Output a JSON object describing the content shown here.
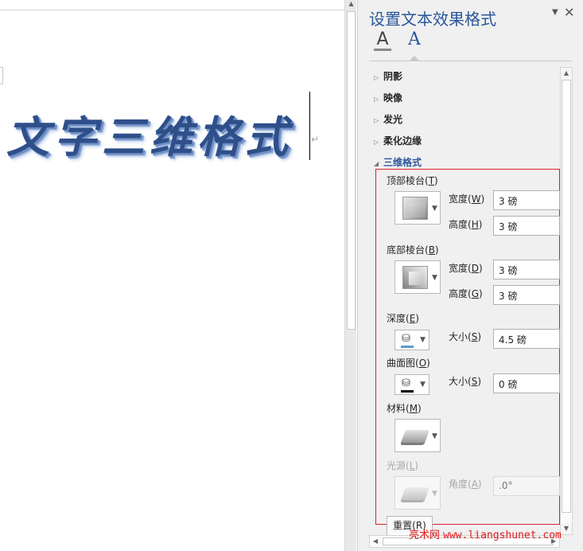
{
  "document": {
    "wordart_text": "文字三维格式",
    "paragraph_mark": "↵"
  },
  "panel": {
    "title": "设置文本效果格式",
    "menu_glyph": "▼",
    "close_glyph": "✕",
    "tabs": {
      "fill_outline_glyph": "A",
      "text_effects_glyph": "A"
    },
    "sections": {
      "shadow": "阴影",
      "reflection": "映像",
      "glow": "发光",
      "soft_edges": "柔化边缘",
      "format_3d": "三维格式"
    },
    "format3d": {
      "top_bevel": {
        "label": "顶部棱台(",
        "key": "T",
        "close": ")"
      },
      "top_width": {
        "label": "宽度(",
        "key": "W",
        "close": ")",
        "value": "3 磅"
      },
      "top_height": {
        "label": "高度(",
        "key": "H",
        "close": ")",
        "value": "3 磅"
      },
      "bottom_bevel": {
        "label": "底部棱台(",
        "key": "B",
        "close": ")"
      },
      "bottom_width": {
        "label": "宽度(",
        "key": "D",
        "close": ")",
        "value": "3 磅"
      },
      "bottom_height": {
        "label": "高度(",
        "key": "G",
        "close": ")",
        "value": "3 磅"
      },
      "depth": {
        "label": "深度(",
        "key": "E",
        "close": ")"
      },
      "depth_size": {
        "label": "大小(",
        "key": "S",
        "close": ")",
        "value": "4.5 磅"
      },
      "contour": {
        "label": "曲面图(",
        "key": "O",
        "close": ")"
      },
      "contour_size": {
        "label": "大小(",
        "key": "S",
        "close": ")",
        "value": "0 磅"
      },
      "material": {
        "label": "材料(",
        "key": "M",
        "close": ")"
      },
      "lighting": {
        "label": "光源(",
        "key": "L",
        "close": ")"
      },
      "angle": {
        "label": "角度(",
        "key": "A",
        "close": ")",
        "value": ".0°"
      },
      "reset": "重置(R)"
    },
    "colors": {
      "depth_color": "#5b9bd5",
      "contour_color": "#000000",
      "highlight_frame": "#d9232e"
    }
  },
  "watermark": {
    "cn": "亮术网",
    "site": "www.liangshunet.com"
  }
}
